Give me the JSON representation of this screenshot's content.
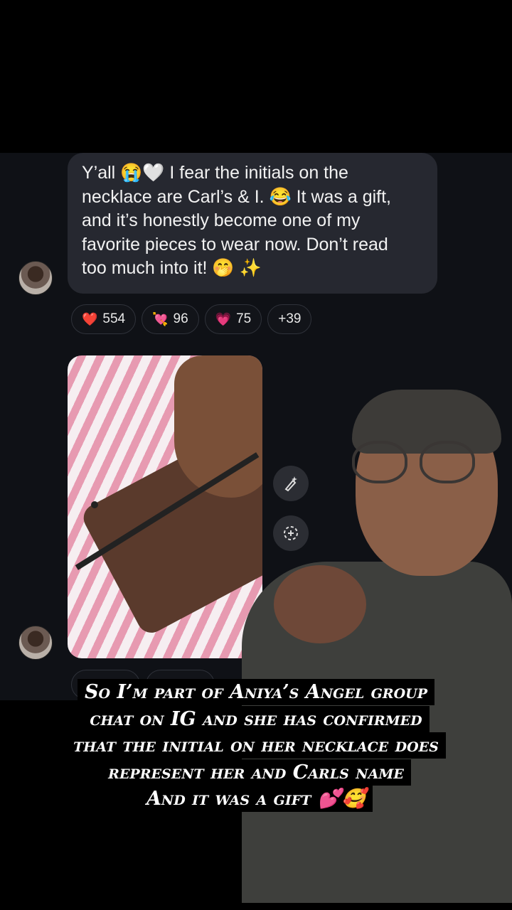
{
  "chat": {
    "message_text": "Y’all 😭🤍 I fear the initials on the\nnecklace are Carl’s & I. 😂 It was a gift,\nand it’s honestly become one of my\nfavorite pieces to wear now. Don’t read\ntoo much into it! 🤭 ✨",
    "reactions": [
      {
        "emoji": "❤️",
        "count": "554"
      },
      {
        "emoji": "💘",
        "count": "96"
      },
      {
        "emoji": "💗",
        "count": "75"
      },
      {
        "emoji": "",
        "count": "+39"
      }
    ],
    "photo_actions": [
      {
        "icon": "paintbrush-sparkle-icon"
      },
      {
        "icon": "add-reaction-icon"
      }
    ]
  },
  "caption": {
    "lines": [
      "So I’m part of Aniya’s Angel group",
      "chat on IG and she has confirmed",
      "that the initial on her necklace does",
      "represent her and Carls name",
      "And it was a gift 💕🥰"
    ]
  }
}
